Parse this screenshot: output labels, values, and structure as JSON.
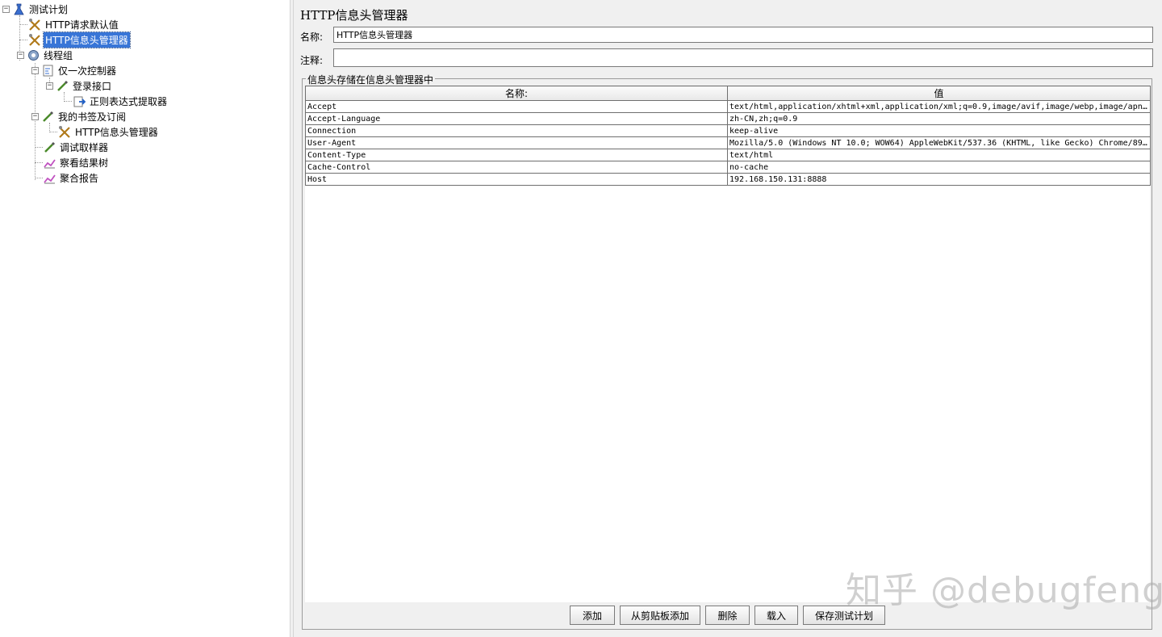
{
  "tree": {
    "nodes": [
      {
        "label": "测试计划",
        "icon": "flask-icon",
        "toggle": "−"
      },
      {
        "label": "HTTP请求默认值",
        "icon": "wrench-screwdriver-icon"
      },
      {
        "label": "HTTP信息头管理器",
        "icon": "wrench-screwdriver-icon"
      },
      {
        "label": "线程组",
        "icon": "gear-icon",
        "toggle": "−"
      },
      {
        "label": "仅一次控制器",
        "icon": "controller-icon",
        "toggle": "−"
      },
      {
        "label": "登录接口",
        "icon": "pipette-icon",
        "toggle": "−"
      },
      {
        "label": "正则表达式提取器",
        "icon": "extractor-icon"
      },
      {
        "label": "我的书签及订阅",
        "icon": "pipette-icon",
        "toggle": "−"
      },
      {
        "label": "HTTP信息头管理器",
        "icon": "wrench-screwdriver-icon"
      },
      {
        "label": "调试取样器",
        "icon": "pipette-icon"
      },
      {
        "label": "察看结果树",
        "icon": "graph-icon"
      },
      {
        "label": "聚合报告",
        "icon": "graph-icon"
      }
    ]
  },
  "panel": {
    "title": "HTTP信息头管理器",
    "name_label": "名称:",
    "name_value": "HTTP信息头管理器",
    "comment_label": "注释:",
    "comment_value": "",
    "group_title": "信息头存储在信息头管理器中",
    "table": {
      "headers": [
        "名称:",
        "值"
      ],
      "rows": [
        [
          "Accept",
          "text/html,application/xhtml+xml,application/xml;q=0.9,image/avif,image/webp,image/apng,*..."
        ],
        [
          "Accept-Language",
          "zh-CN,zh;q=0.9"
        ],
        [
          "Connection",
          "keep-alive"
        ],
        [
          "User-Agent",
          "Mozilla/5.0 (Windows NT 10.0; WOW64) AppleWebKit/537.36 (KHTML, like Gecko) Chrome/89.0...."
        ],
        [
          "Content-Type",
          "text/html"
        ],
        [
          "Cache-Control",
          "no-cache"
        ],
        [
          "Host",
          "192.168.150.131:8888"
        ]
      ]
    },
    "buttons": {
      "add": "添加",
      "add_clipboard": "从剪贴板添加",
      "delete": "删除",
      "load": "载入",
      "save_plan": "保存测试计划"
    }
  },
  "watermark": "知乎 @debugfeng",
  "colors": {
    "selection": "#3875d7",
    "panel_bg": "#f0f0f0"
  }
}
